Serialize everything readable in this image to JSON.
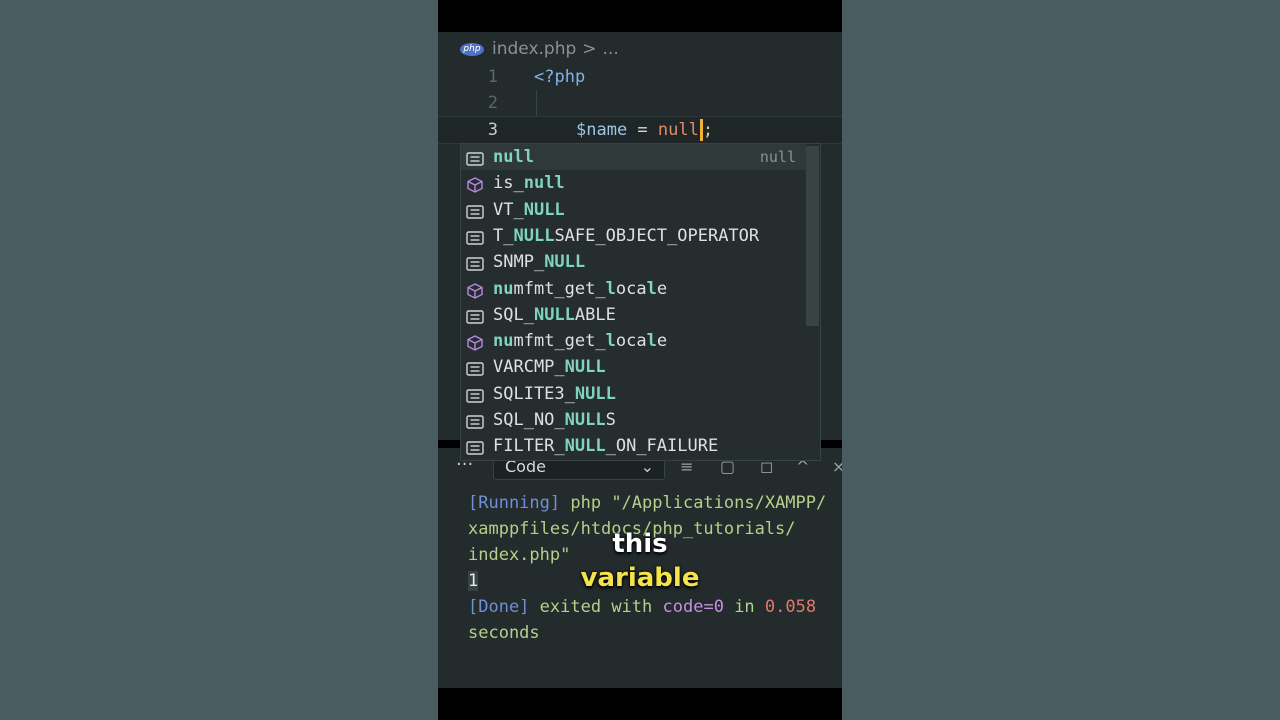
{
  "breadcrumb": {
    "file": "index.php",
    "separator": ">",
    "more": "...",
    "badge": "php"
  },
  "editor": {
    "lines": [
      {
        "number": "1",
        "text": "<?php"
      },
      {
        "number": "2",
        "text": ""
      },
      {
        "number": "3",
        "var": "$name",
        "op": " = ",
        "value": "null",
        "semi": ";"
      }
    ]
  },
  "suggestions": [
    {
      "pre": "",
      "hl": "null",
      "post": "",
      "kind": "constant",
      "detail": "null"
    },
    {
      "pre": "is_",
      "hl": "null",
      "post": "",
      "kind": "function"
    },
    {
      "pre": "VT_",
      "hl": "NULL",
      "post": "",
      "kind": "constant"
    },
    {
      "pre": "T_",
      "hl": "NULL",
      "post": "SAFE_OBJECT_OPERATOR",
      "kind": "constant"
    },
    {
      "pre": "SNMP_",
      "hl": "NULL",
      "post": "",
      "kind": "constant"
    },
    {
      "segments": [
        [
          "nu",
          true
        ],
        [
          "mfmt_get_",
          false
        ],
        [
          "l",
          true
        ],
        [
          "oca",
          false
        ],
        [
          "l",
          true
        ],
        [
          "e",
          false
        ]
      ],
      "kind": "function"
    },
    {
      "pre": "SQL_",
      "hl": "NULL",
      "post": "ABLE",
      "kind": "constant"
    },
    {
      "segments": [
        [
          "nu",
          true
        ],
        [
          "mfmt_get_",
          false
        ],
        [
          "l",
          true
        ],
        [
          "oca",
          false
        ],
        [
          "l",
          true
        ],
        [
          "e",
          false
        ]
      ],
      "kind": "function"
    },
    {
      "pre": "VARCMP_",
      "hl": "NULL",
      "post": "",
      "kind": "constant"
    },
    {
      "pre": "SQLITE3_",
      "hl": "NULL",
      "post": "",
      "kind": "constant"
    },
    {
      "pre": "SQL_NO_",
      "hl": "NULL",
      "post": "S",
      "kind": "constant"
    },
    {
      "pre": "FILTER_",
      "hl": "NULL",
      "post": "_ON_FAILURE",
      "kind": "constant"
    }
  ],
  "panel": {
    "dots": "···",
    "select_value": "Code"
  },
  "output": {
    "running_tag": "[Running]",
    "running_cmd_1": "php \"/Applications/XAMPP/",
    "running_cmd_2": "xamppfiles/htdocs/php_tutorials/",
    "running_cmd_3": "index.php\"",
    "result": "1",
    "done_tag": "[Done]",
    "done_text": "exited with",
    "done_code": "code=0",
    "done_in": "in",
    "done_time": "0.058",
    "done_unit": "seconds"
  },
  "captions": {
    "line1": "this",
    "line2": "variable"
  },
  "colors": {
    "accent_cursor": "#f2b23a",
    "highlight": "#7fd3c0",
    "caption_yellow": "#f6e24a"
  }
}
